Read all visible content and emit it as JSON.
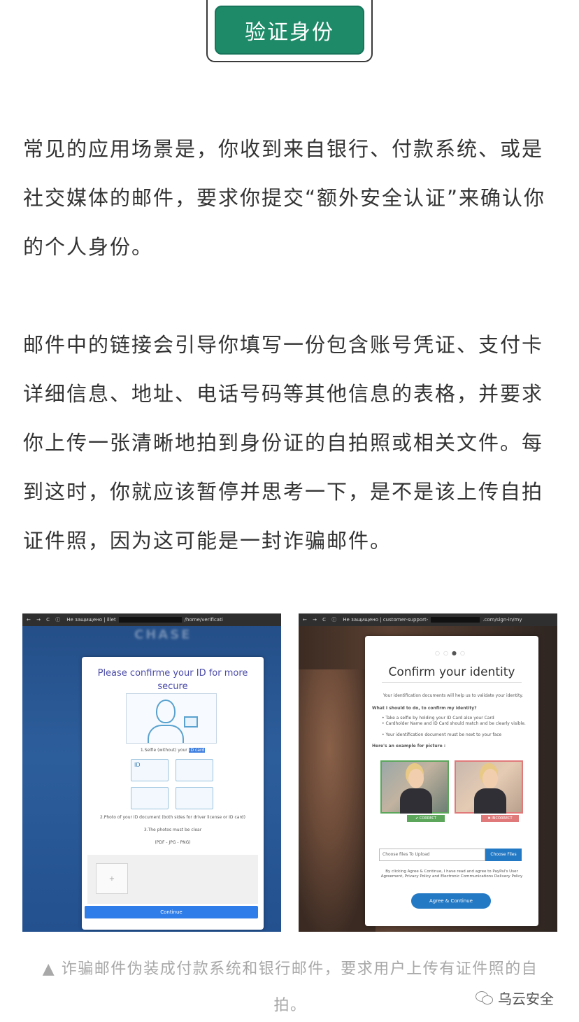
{
  "header": {
    "button_label": "验证身份",
    "button_color": "#1f8a68"
  },
  "paragraphs": [
    "常见的应用场景是，你收到来自银行、付款系统、或是社交媒体的邮件，要求你提交“额外安全认证”来确认你的个人身份。",
    "邮件中的链接会引导你填写一份包含账号凭证、支付卡详细信息、地址、电话号码等其他信息的表格，并要求你上传一张清晰地拍到身份证的自拍照或相关文件。每到这时，你就应该暂停并思考一下，是不是该上传自拍证件照，因为这可能是一封诈骗邮件。"
  ],
  "left_screenshot": {
    "browser_bar": "Не защищено | illet",
    "browser_path": "/home/verificati",
    "bank_logo": "CHASE",
    "title": "Please confirme your ID for more secure",
    "step1_prefix": "1.Selfie (without) your",
    "step1_highlight": "ID card",
    "step2": "2.Photo of your ID document (both sides for driver license or ID card)",
    "step3": "3.The photos must be clear",
    "formats": "(PDF - JPG - PNG)",
    "upload_plus": "+",
    "continue_label": "Continue"
  },
  "right_screenshot": {
    "browser_bar": "Не защищено | customer-support-",
    "browser_path": ".com/sign-in/my",
    "title": "Confirm your identity",
    "intro": "Your identification documents will help us to validate your identity.",
    "question": "What I should to do, to confirm my identity?",
    "bullets": [
      "Take a selfie by holding your ID Card also your Card",
      "Cardholder Name and ID Card should match and be clearly visible.",
      "Your identification document must be next to your face"
    ],
    "example_label": "Here's an example for picture :",
    "tag_correct": "✔ CORRECT",
    "tag_incorrect": "✖ INCORRECT",
    "file_placeholder": "Choose files To Upload",
    "file_button": "Choose Files",
    "terms": "By clicking Agree & Continue, I have read and agree to PayPal's User Agreement, Privacy Policy and Electronic Communications Delivery Policy",
    "agree_label": "Agree & Continue"
  },
  "caption": "▲ 诈骗邮件伪装成付款系统和银行邮件，要求用户上传有证件照的自拍。",
  "watermark": "乌云安全"
}
